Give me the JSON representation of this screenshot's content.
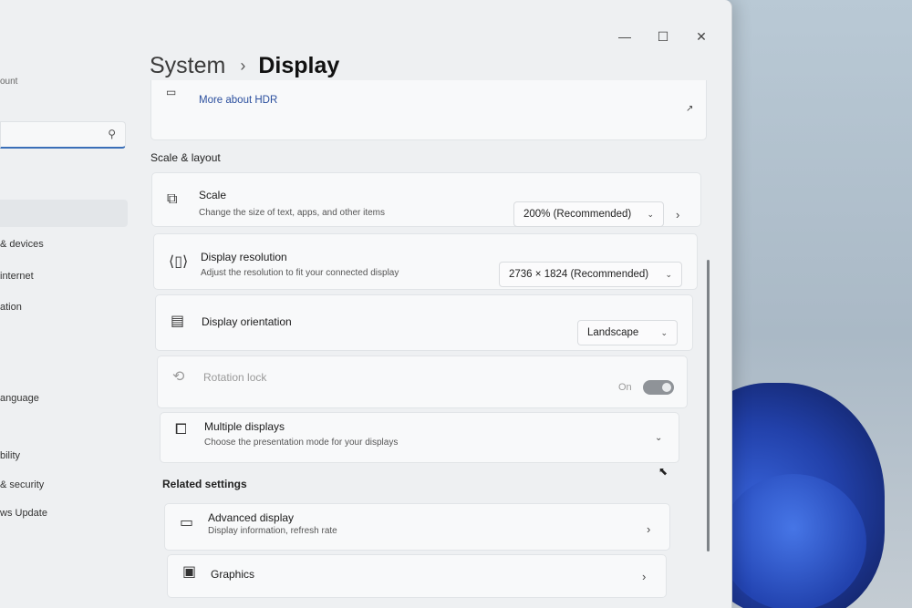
{
  "nav": {
    "account_fragment": "ount",
    "items": [
      {
        "label": "& devices"
      },
      {
        "label": "internet"
      },
      {
        "label": "ation"
      },
      {
        "label": "anguage"
      },
      {
        "label": "bility"
      },
      {
        "label": "& security"
      },
      {
        "label": "ws Update"
      }
    ]
  },
  "header": {
    "parent": "System",
    "separator": "›",
    "current": "Display"
  },
  "hdr": {
    "link": "More about HDR"
  },
  "scale_layout": {
    "section_title": "Scale & layout",
    "scale": {
      "title": "Scale",
      "subtitle": "Change the size of text, apps, and other items",
      "value": "200% (Recommended)"
    },
    "resolution": {
      "title": "Display resolution",
      "subtitle": "Adjust the resolution to fit your connected display",
      "value": "2736 × 1824 (Recommended)"
    },
    "orientation": {
      "title": "Display orientation",
      "value": "Landscape"
    },
    "rotation_lock": {
      "title": "Rotation lock",
      "state": "On"
    },
    "multiple_displays": {
      "title": "Multiple displays",
      "subtitle": "Choose the presentation mode for your displays"
    }
  },
  "related": {
    "section_title": "Related settings",
    "advanced": {
      "title": "Advanced display",
      "subtitle": "Display information, refresh rate"
    },
    "graphics": {
      "title": "Graphics"
    }
  },
  "icons": {
    "search": "search-icon",
    "chevron_down": "chevron-down-icon",
    "chevron_right": "chevron-right-icon"
  },
  "colors": {
    "accent": "#3a6fb8",
    "link": "#2b4f9e",
    "toggle_off_disabled": "#8f9398"
  }
}
